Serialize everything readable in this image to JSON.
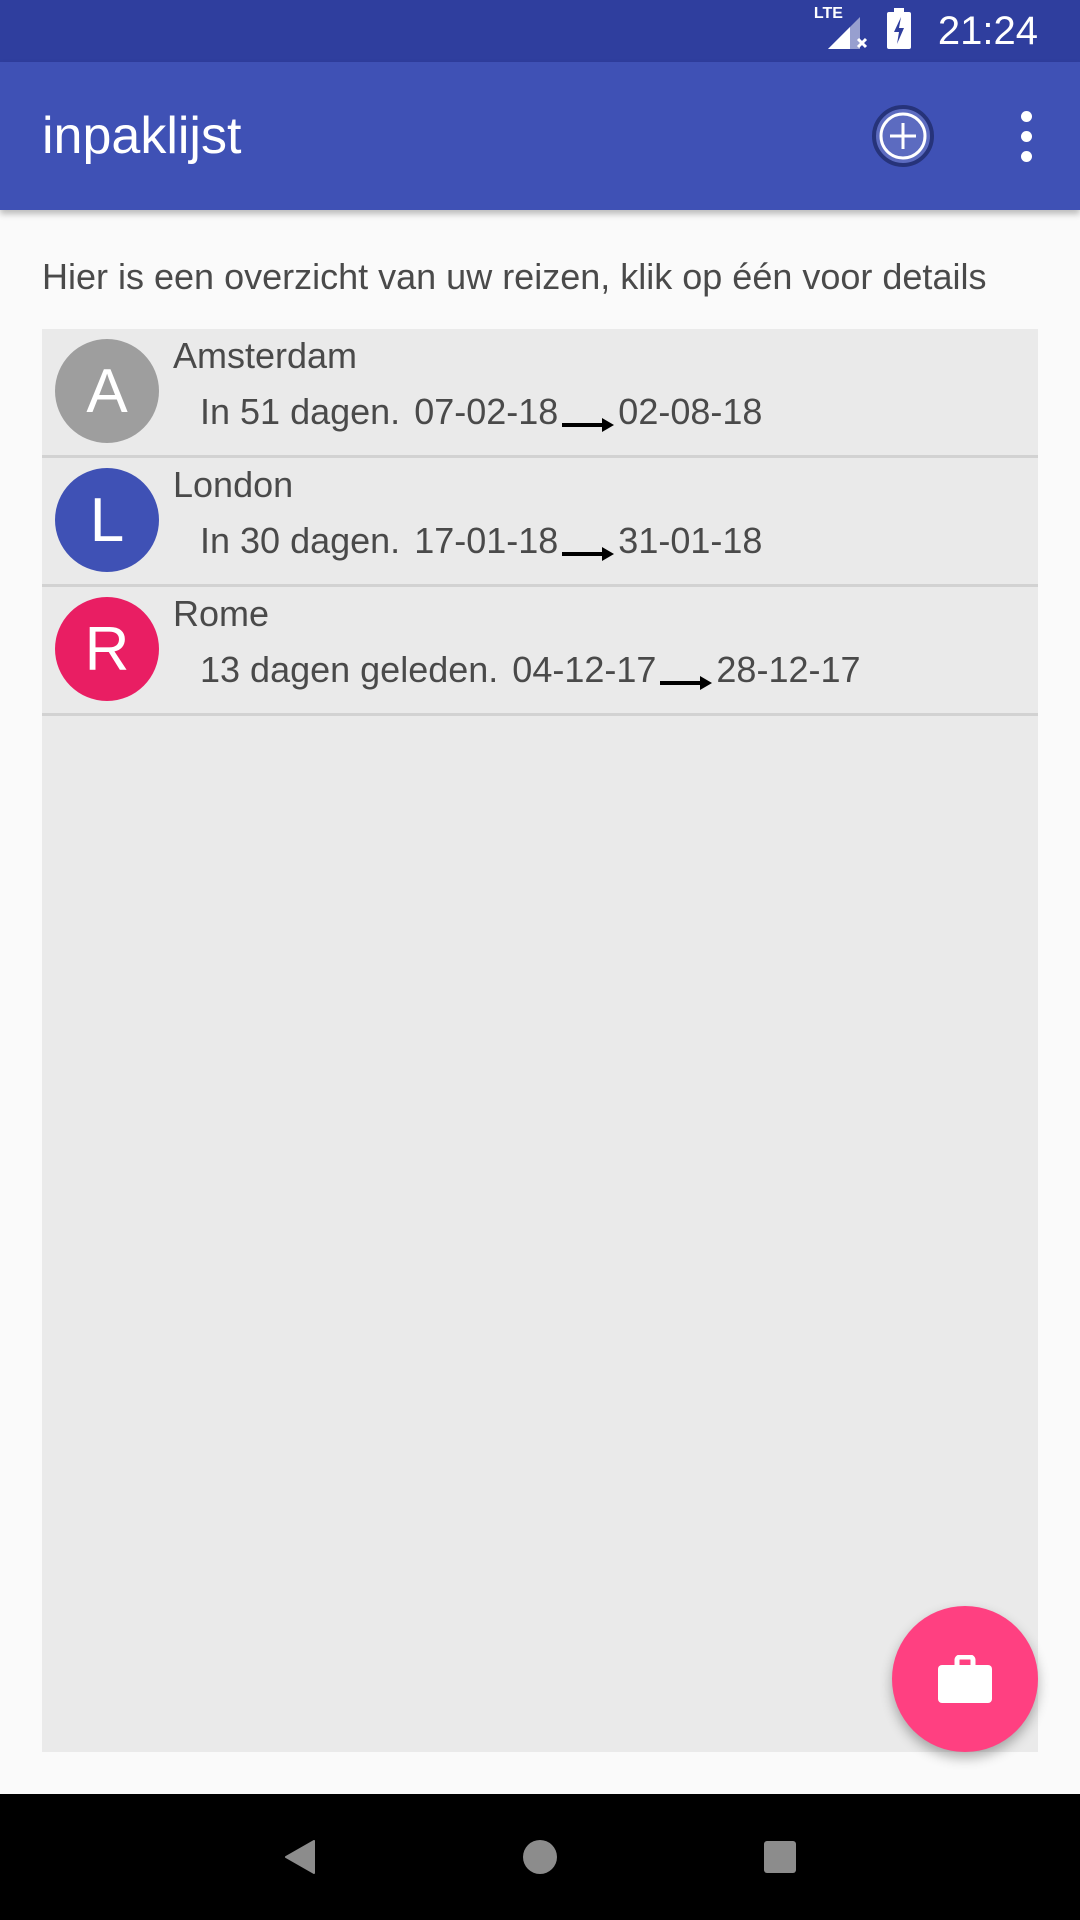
{
  "status_bar": {
    "network_label": "LTE",
    "time": "21:24"
  },
  "app_bar": {
    "title": "inpaklijst",
    "add_icon": "add-circle-icon",
    "overflow_icon": "more-vert-icon"
  },
  "intro_text": "Hier is een overzicht van uw reizen, klik op één voor details",
  "trips": [
    {
      "initial": "A",
      "name": "Amsterdam",
      "countdown": "In 51 dagen.",
      "start": "07-02-18",
      "end": "02-08-18",
      "color": "#9e9e9e"
    },
    {
      "initial": "L",
      "name": "London",
      "countdown": "In 30 dagen.",
      "start": "17-01-18",
      "end": "31-01-18",
      "color": "#3f51b5"
    },
    {
      "initial": "R",
      "name": "Rome",
      "countdown": "13 dagen geleden.",
      "start": "04-12-17",
      "end": "28-12-17",
      "color": "#e91e63"
    }
  ],
  "fab": {
    "icon": "briefcase-icon",
    "color": "#ff4081"
  },
  "colors": {
    "status_bar": "#2f3e9e",
    "app_bar": "#3f51b5",
    "list_background": "#eaeaea"
  }
}
